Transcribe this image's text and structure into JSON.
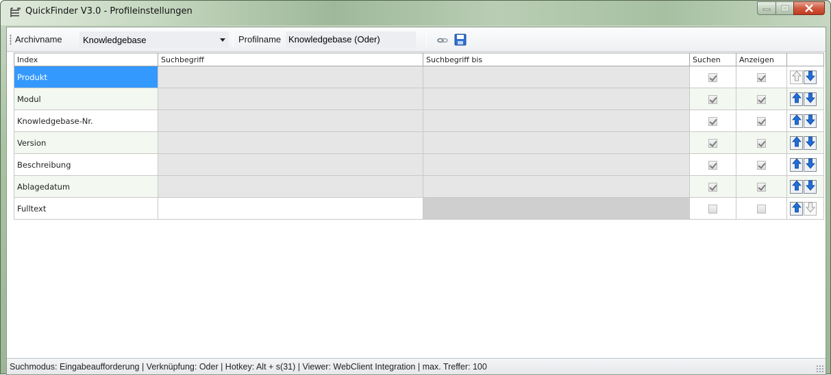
{
  "window": {
    "title": "QuickFinder V3.0 - Profileinstellungen",
    "icon": "app-tree-icon"
  },
  "toolbar": {
    "archiv_label": "Archivname",
    "archiv_value": "Knowledgebase",
    "profil_label": "Profilname",
    "profil_value": "Knowledgebase (Oder)",
    "link_icon": "link-icon",
    "save_icon": "save-icon"
  },
  "grid": {
    "headers": [
      "Index",
      "Suchbegriff",
      "Suchbegriff bis",
      "Suchen",
      "Anzeigen",
      ""
    ],
    "rows": [
      {
        "index": "Produkt",
        "suchen": true,
        "anzeigen": true,
        "up_enabled": false,
        "down_enabled": true
      },
      {
        "index": "Modul",
        "suchen": true,
        "anzeigen": true,
        "up_enabled": true,
        "down_enabled": true
      },
      {
        "index": "Knowledgebase-Nr.",
        "suchen": true,
        "anzeigen": true,
        "up_enabled": true,
        "down_enabled": true
      },
      {
        "index": "Version",
        "suchen": true,
        "anzeigen": true,
        "up_enabled": true,
        "down_enabled": true
      },
      {
        "index": "Beschreibung",
        "suchen": true,
        "anzeigen": true,
        "up_enabled": true,
        "down_enabled": true
      },
      {
        "index": "Ablagedatum",
        "suchen": true,
        "anzeigen": true,
        "up_enabled": true,
        "down_enabled": true
      },
      {
        "index": "Fulltext",
        "suchen": false,
        "anzeigen": false,
        "up_enabled": true,
        "down_enabled": false
      }
    ],
    "selected_row": 0
  },
  "statusbar": {
    "text": "Suchmodus:  Eingabeaufforderung  |  Verknüpfung:  Oder  |  Hotkey:  Alt + s(31)  |  Viewer:  WebClient Integration  |  max. Treffer:  100"
  },
  "colors": {
    "selection": "#3399ff",
    "arrow_blue": "#1e6fd9",
    "alt_row": "#f3f9f1"
  }
}
